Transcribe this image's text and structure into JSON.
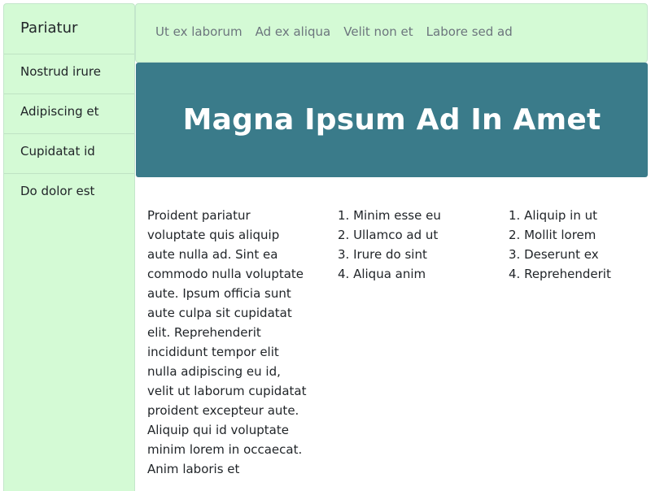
{
  "sidebar": {
    "brand": "Pariatur",
    "items": [
      {
        "label": "Nostrud irure"
      },
      {
        "label": "Adipiscing et"
      },
      {
        "label": "Cupidatat id"
      },
      {
        "label": "Do dolor est"
      }
    ]
  },
  "topnav": {
    "links": [
      {
        "label": "Ut ex laborum"
      },
      {
        "label": "Ad ex aliqua"
      },
      {
        "label": "Velit non et"
      },
      {
        "label": "Labore sed ad"
      }
    ]
  },
  "hero": {
    "title": "Magna Ipsum Ad In Amet"
  },
  "main": {
    "paragraph": "Proident pariatur voluptate quis aliquip aute nulla ad. Sint ea commodo nulla voluptate aute. Ipsum officia sunt aute culpa sit cupidatat elit. Reprehenderit incididunt tempor elit nulla adipiscing eu id, velit ut laborum cupidatat proident excepteur aute. Aliquip qui id voluptate minim lorem in occaecat. Anim laboris et",
    "list_one": [
      "1. Minim esse eu",
      "2. Ullamco ad ut",
      "3. Irure do sint",
      "4. Aliqua anim"
    ],
    "list_two": [
      "1. Aliquip in ut",
      "2. Mollit lorem",
      "3. Deserunt ex",
      "4. Reprehenderit"
    ]
  },
  "colors": {
    "sidebar_bg": "#d4fad5",
    "hero_bg": "#3a7b8a",
    "nav_link": "#6c757d"
  }
}
